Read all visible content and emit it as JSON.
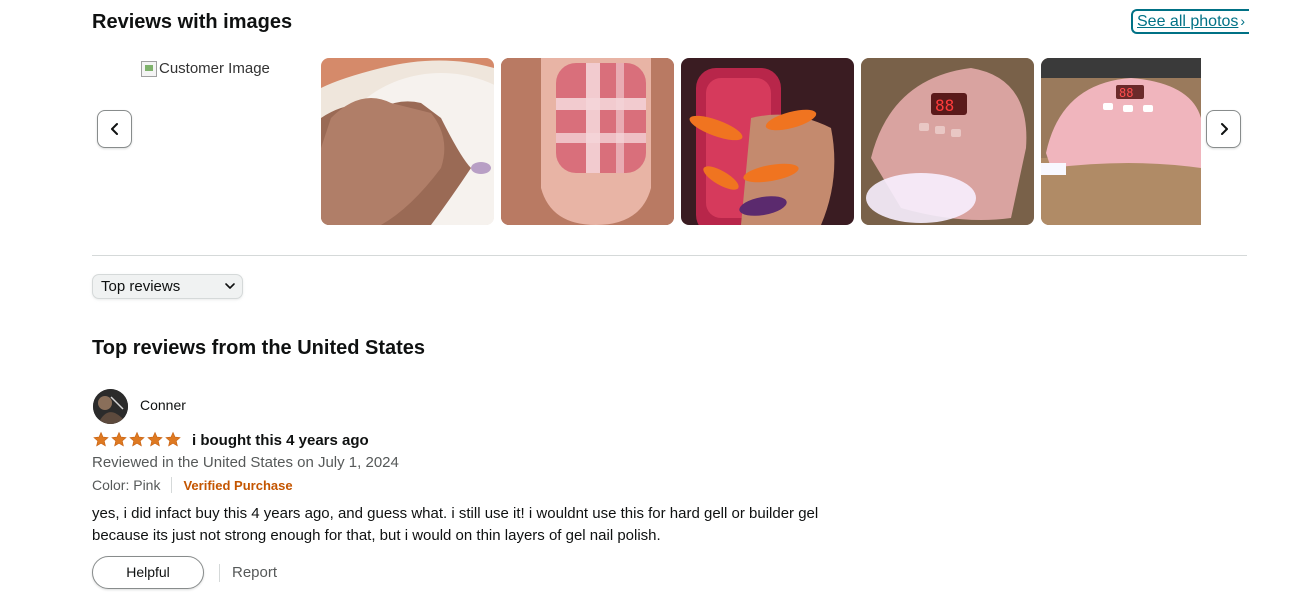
{
  "images_section": {
    "title": "Reviews with images",
    "see_all_label": "See all photos",
    "broken_image_alt": "Customer Image"
  },
  "sort": {
    "selected": "Top reviews"
  },
  "reviews_heading": "Top reviews from the United States",
  "review": {
    "reviewer_name": "Conner",
    "rating": 5,
    "title": "i bought this 4 years ago",
    "date_line": "Reviewed in the United States on July 1, 2024",
    "variant": "Color: Pink",
    "verified": "Verified Purchase",
    "body": "yes, i did infact buy this 4 years ago, and guess what. i still use it! i wouldnt use this for hard gell or builder gel because its just not strong enough for that, but i would on thin layers of gel nail polish.",
    "helpful_label": "Helpful",
    "report_label": "Report"
  },
  "colors": {
    "link": "#007185",
    "star": "#de7921",
    "verified": "#c45500"
  }
}
